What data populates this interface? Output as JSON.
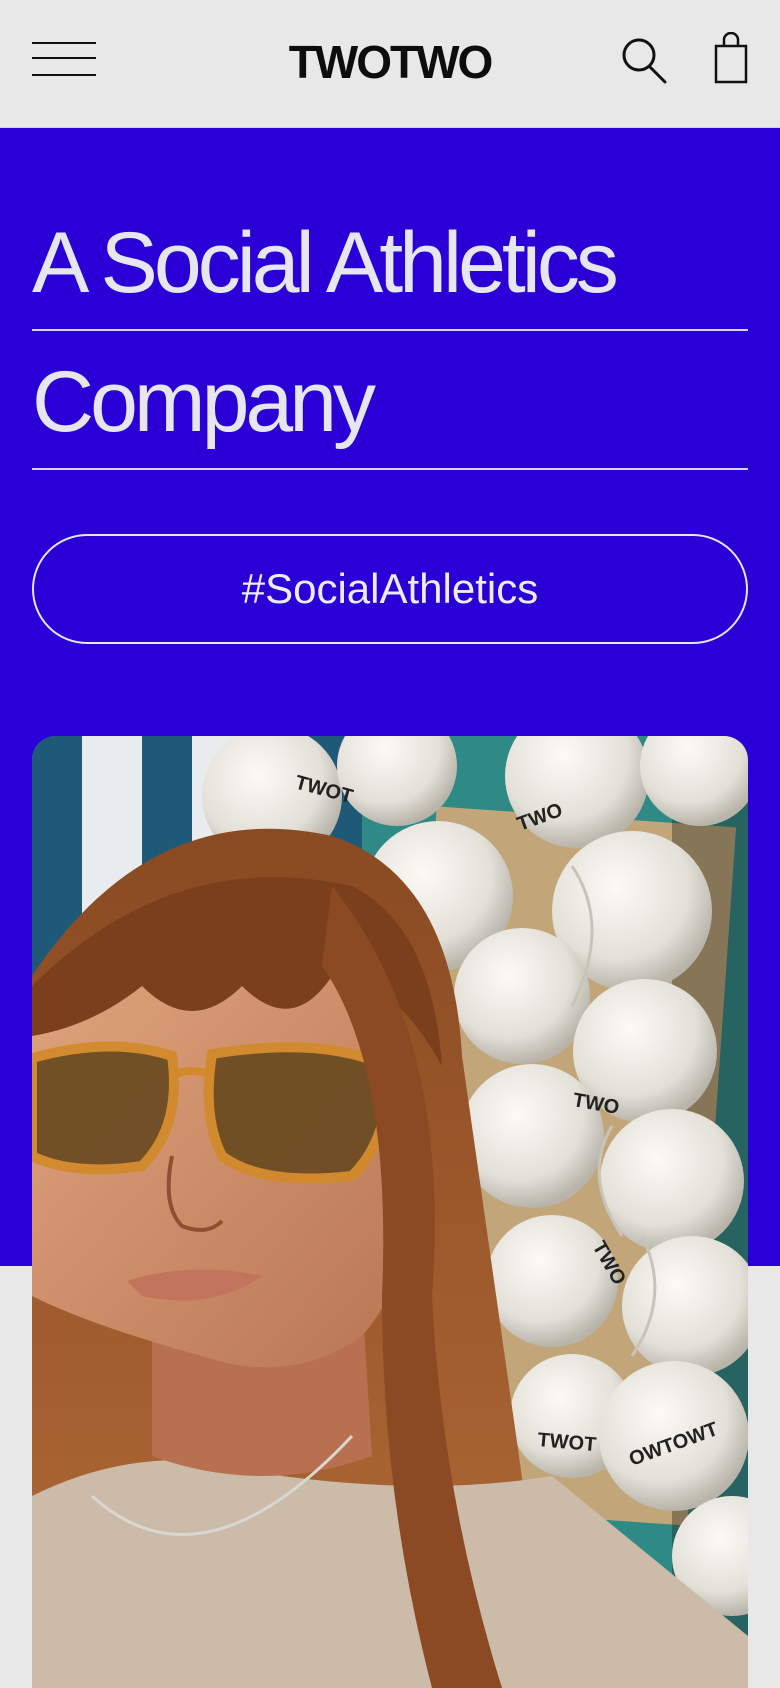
{
  "header": {
    "logo": "TWOTWO",
    "menu_icon": "hamburger-menu-icon",
    "search_icon": "search-icon",
    "bag_icon": "shopping-bag-icon"
  },
  "hero": {
    "headline_line1": "A Social Athletics",
    "headline_line2": "Company",
    "tag_button": "#SocialAthletics",
    "background_color": "#2a00d6",
    "text_color": "#e6e6ee"
  },
  "photo": {
    "ball_labels": [
      "TWOT",
      "TWO",
      "TWO",
      "TWO",
      "OWTOWT",
      "TWOT"
    ]
  }
}
